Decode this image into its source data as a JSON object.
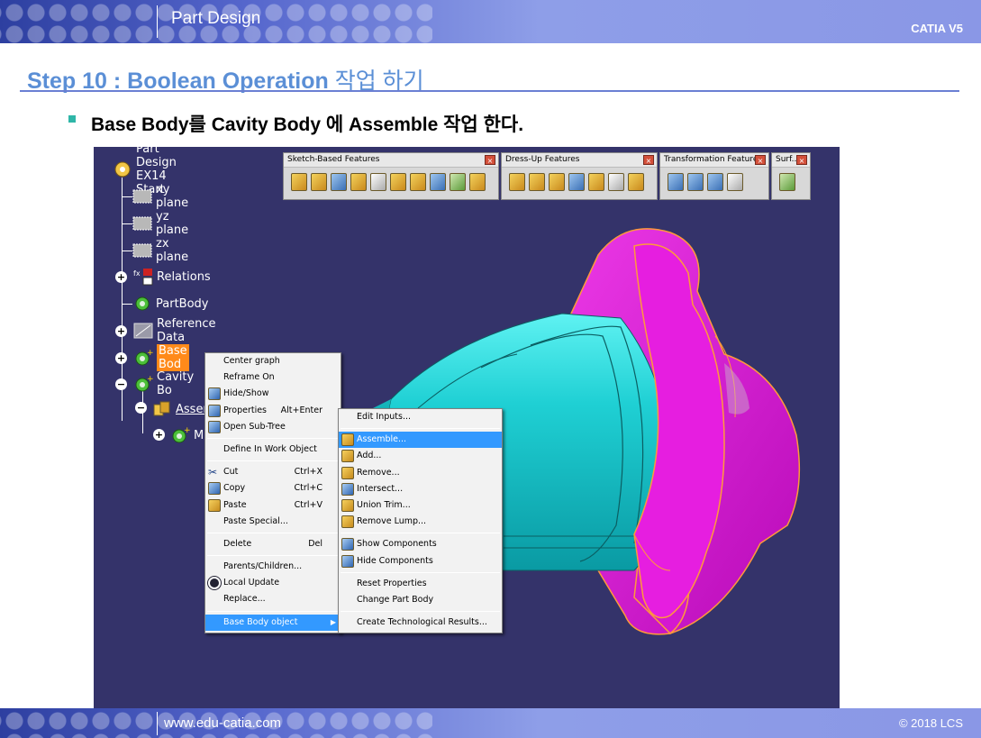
{
  "header": {
    "title": "Part Design",
    "product": "CATIA V5"
  },
  "step": {
    "title": "Step 10 : Boolean Operation",
    "title_kr": "작업 하기"
  },
  "bullet": {
    "text": "Base Body를 Cavity Body 에 Assemble 작업 한다."
  },
  "footer": {
    "url": "www.edu-catia.com",
    "copyright": "© 2018 LCS"
  },
  "tree": {
    "root": "Part Design EX14 Start",
    "xy": "xy plane",
    "yz": "yz plane",
    "zx": "zx plane",
    "relations": "Relations",
    "partbody": "PartBody",
    "refdata": "Reference Data",
    "basebody": "Base Bod",
    "cavity": "Cavity Bo",
    "assemble": "Assem",
    "m": "M"
  },
  "toolbars": {
    "sketch": "Sketch-Based Features",
    "dressup": "Dress-Up Features",
    "transform": "Transformation Features",
    "surf": "Surf..."
  },
  "menu1": {
    "center_graph": "Center graph",
    "reframe_on": "Reframe On",
    "hide_show": "Hide/Show",
    "properties": "Properties",
    "properties_sc": "Alt+Enter",
    "open_subtree": "Open Sub-Tree",
    "define_work": "Define In Work Object",
    "cut": "Cut",
    "cut_sc": "Ctrl+X",
    "copy": "Copy",
    "copy_sc": "Ctrl+C",
    "paste": "Paste",
    "paste_sc": "Ctrl+V",
    "paste_special": "Paste Special...",
    "delete": "Delete",
    "delete_sc": "Del",
    "parents_children": "Parents/Children...",
    "local_update": "Local Update",
    "replace": "Replace...",
    "object": "Base Body object"
  },
  "menu2": {
    "edit_inputs": "Edit Inputs...",
    "assemble": "Assemble...",
    "add": "Add...",
    "remove": "Remove...",
    "intersect": "Intersect...",
    "union_trim": "Union Trim...",
    "remove_lump": "Remove Lump...",
    "show_components": "Show Components",
    "hide_components": "Hide Components",
    "reset_properties": "Reset Properties",
    "change_part_body": "Change Part Body",
    "create_tech": "Create Technological Results..."
  },
  "colors": {
    "header_bar": "#5566cc",
    "title_blue": "#5b8fd6",
    "viewport_bg": "#34336a",
    "part_cyan": "#1fd0d4",
    "part_magenta": "#e61ee0",
    "highlight_orange": "#ff8a1a",
    "menu_selection": "#3399ff"
  }
}
